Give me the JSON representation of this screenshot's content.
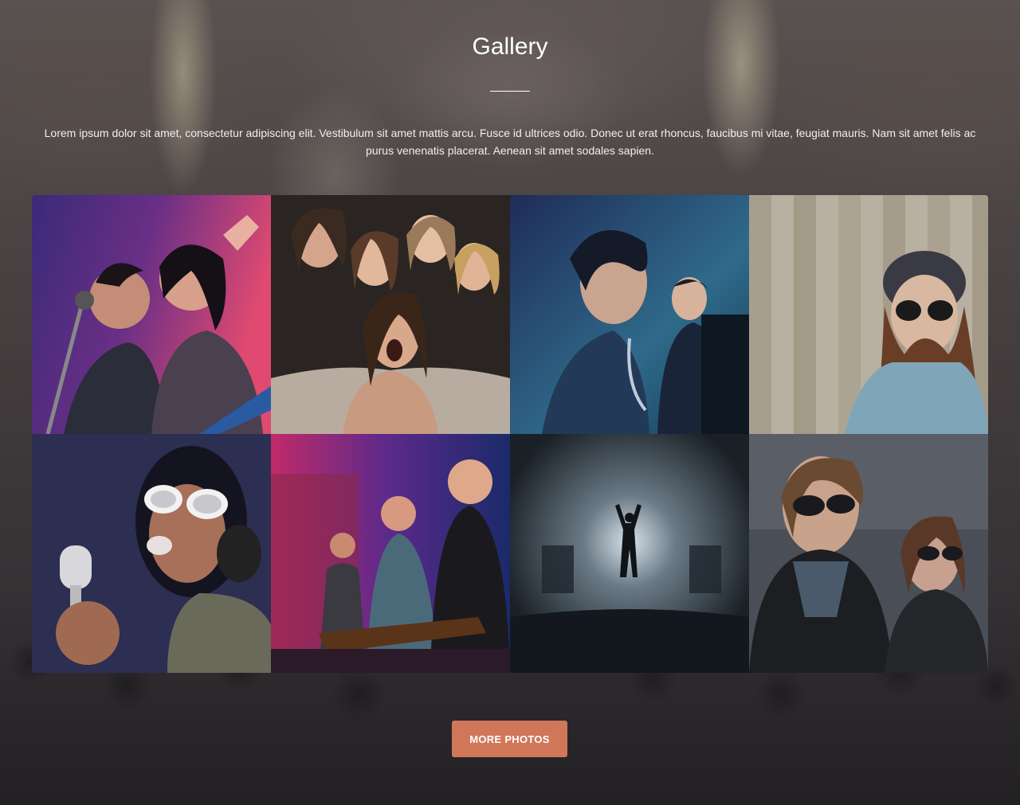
{
  "section": {
    "title": "Gallery",
    "description": "Lorem ipsum dolor sit amet, consectetur adipiscing elit. Vestibulum sit amet mattis arcu. Fusce id ultrices odio. Donec ut erat rhoncus, faucibus mi vitae, feugiat mauris. Nam sit amet felis ac purus venenatis placerat. Aenean sit amet sodales sapien."
  },
  "button": {
    "label": "MORE PHOTOS",
    "color": "#d0775a"
  }
}
